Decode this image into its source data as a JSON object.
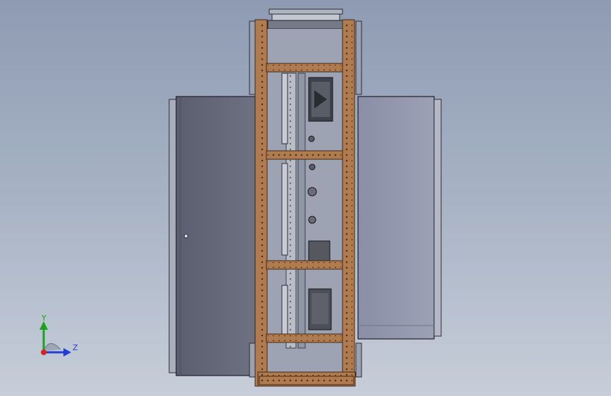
{
  "viewport": {
    "background_top": "#8e9bb3",
    "background_bottom": "#c7ced9"
  },
  "model": {
    "frame_color": "#b07b4f",
    "frame_dark": "#5e3e22",
    "left_door_color": "#676a7b",
    "right_panel_color": "#9599b0",
    "steel_color": "#8f96a6"
  },
  "triad": {
    "y_label": "Y",
    "z_label": "Z",
    "y_color": "#1aa31a",
    "z_color": "#1f3fd1",
    "origin_color": "#d8241c",
    "icons": [
      "axis-triad-icon"
    ]
  }
}
